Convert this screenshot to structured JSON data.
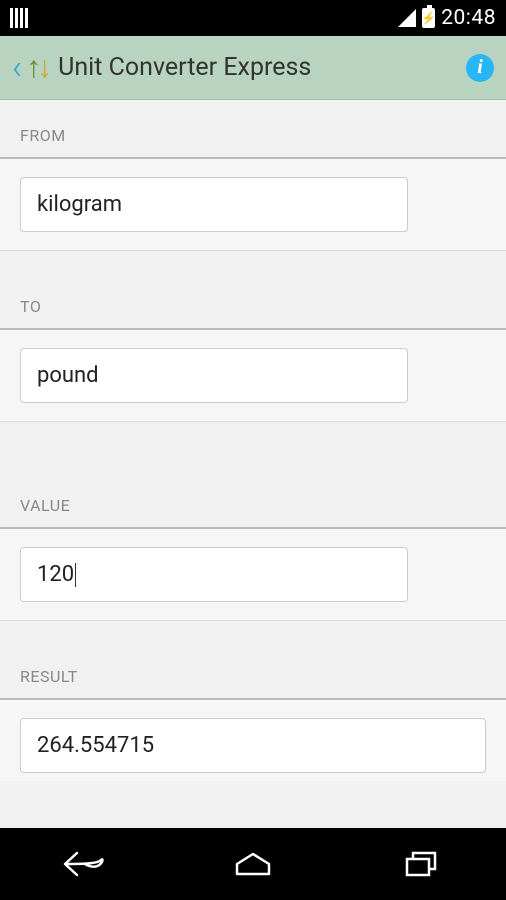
{
  "status": {
    "time": "20:48"
  },
  "appbar": {
    "title": "Unit Converter Express"
  },
  "sections": {
    "from": {
      "label": "FROM",
      "value": "kilogram"
    },
    "to": {
      "label": "TO",
      "value": "pound"
    },
    "value": {
      "label": "VALUE",
      "value": "120"
    },
    "result": {
      "label": "RESULT",
      "value": "264.554715"
    }
  }
}
